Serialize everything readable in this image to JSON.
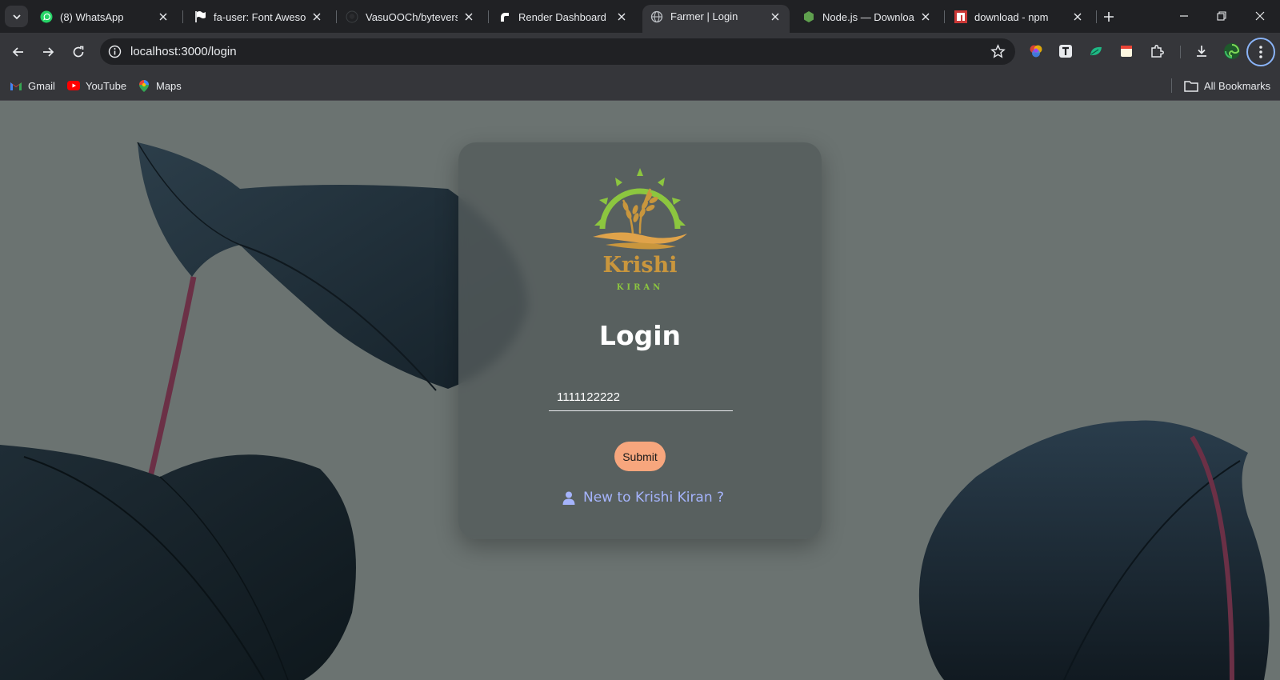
{
  "browser": {
    "tabs": [
      {
        "title": "(8) WhatsApp",
        "icon": "whatsapp-icon",
        "active": false
      },
      {
        "title": "fa-user: Font Awesome",
        "icon": "flag-icon",
        "active": false
      },
      {
        "title": "VasuOOCh/byteverse",
        "icon": "github-icon",
        "active": false
      },
      {
        "title": "Render Dashboard",
        "icon": "render-icon",
        "active": false
      },
      {
        "title": "Farmer | Login",
        "icon": "globe-icon",
        "active": true
      },
      {
        "title": "Node.js — Download",
        "icon": "nodejs-icon",
        "active": false
      },
      {
        "title": "download - npm",
        "icon": "npm-icon",
        "active": false
      }
    ],
    "address": "localhost:3000/login",
    "bookmarks": [
      {
        "label": "Gmail",
        "icon": "gmail-icon"
      },
      {
        "label": "YouTube",
        "icon": "youtube-icon"
      },
      {
        "label": "Maps",
        "icon": "maps-icon"
      }
    ],
    "all_bookmarks_label": "All Bookmarks"
  },
  "logo": {
    "name": "Krishi",
    "sub": "KIRAN"
  },
  "login": {
    "title": "Login",
    "phone_value": "1111122222",
    "submit_label": "Submit",
    "register_link": "New to Krishi Kiran ?"
  },
  "colors": {
    "page_bg": "#6b7371",
    "card_bg": "#545b5c",
    "submit_bg": "#f7a67d",
    "link": "#a5b4fc",
    "logo_green": "#8cc63f",
    "logo_gold": "#c9963d"
  }
}
